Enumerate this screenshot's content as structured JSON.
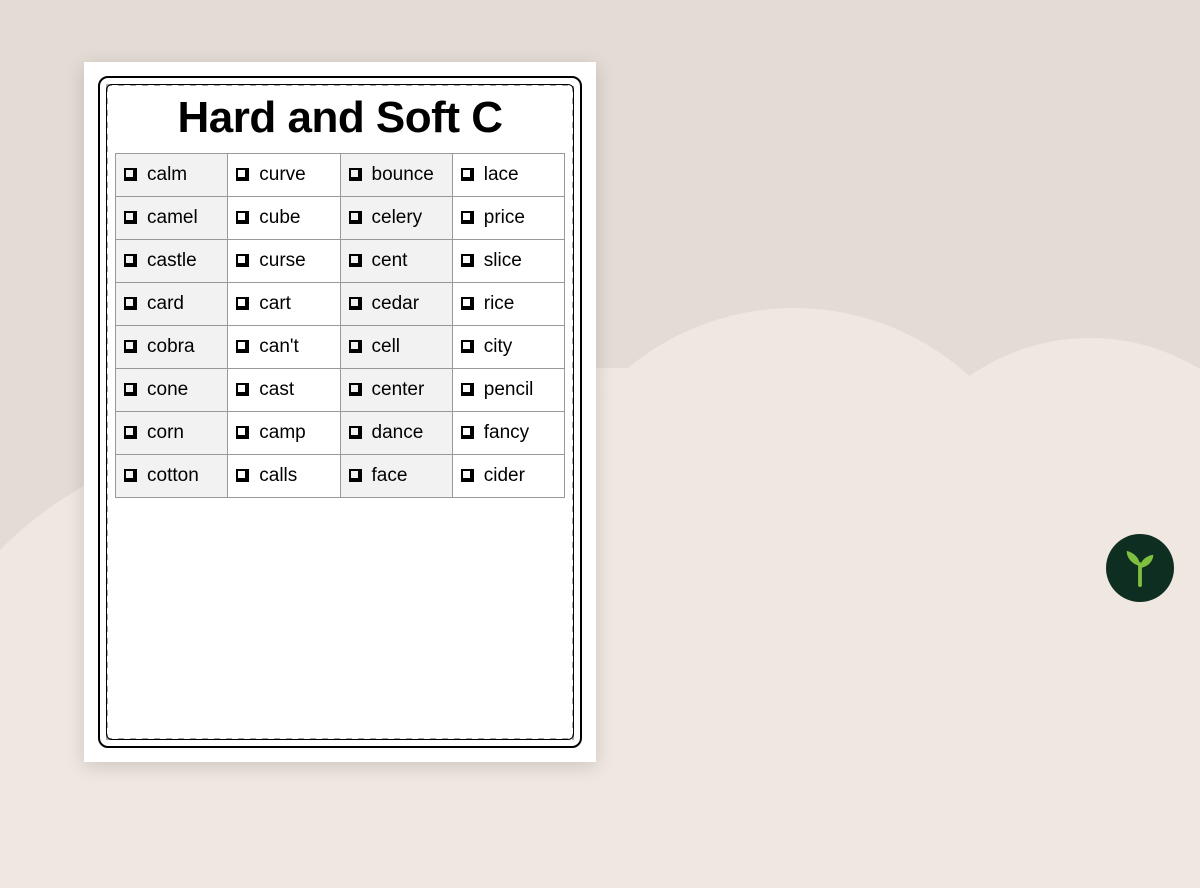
{
  "worksheet": {
    "title": "Hard and Soft C",
    "columns": [
      [
        "calm",
        "camel",
        "castle",
        "card",
        "cobra",
        "cone",
        "corn",
        "cotton"
      ],
      [
        "curve",
        "cube",
        "curse",
        "cart",
        "can't",
        "cast",
        "camp",
        "calls"
      ],
      [
        "bounce",
        "celery",
        "cent",
        "cedar",
        "cell",
        "center",
        "dance",
        "face"
      ],
      [
        "lace",
        "price",
        "slice",
        "rice",
        "city",
        "pencil",
        "fancy",
        "cider"
      ]
    ],
    "shaded_columns": [
      0,
      2
    ]
  },
  "badge": {
    "brand_color": "#7fbf3f",
    "bg_color": "#0f2e22"
  }
}
